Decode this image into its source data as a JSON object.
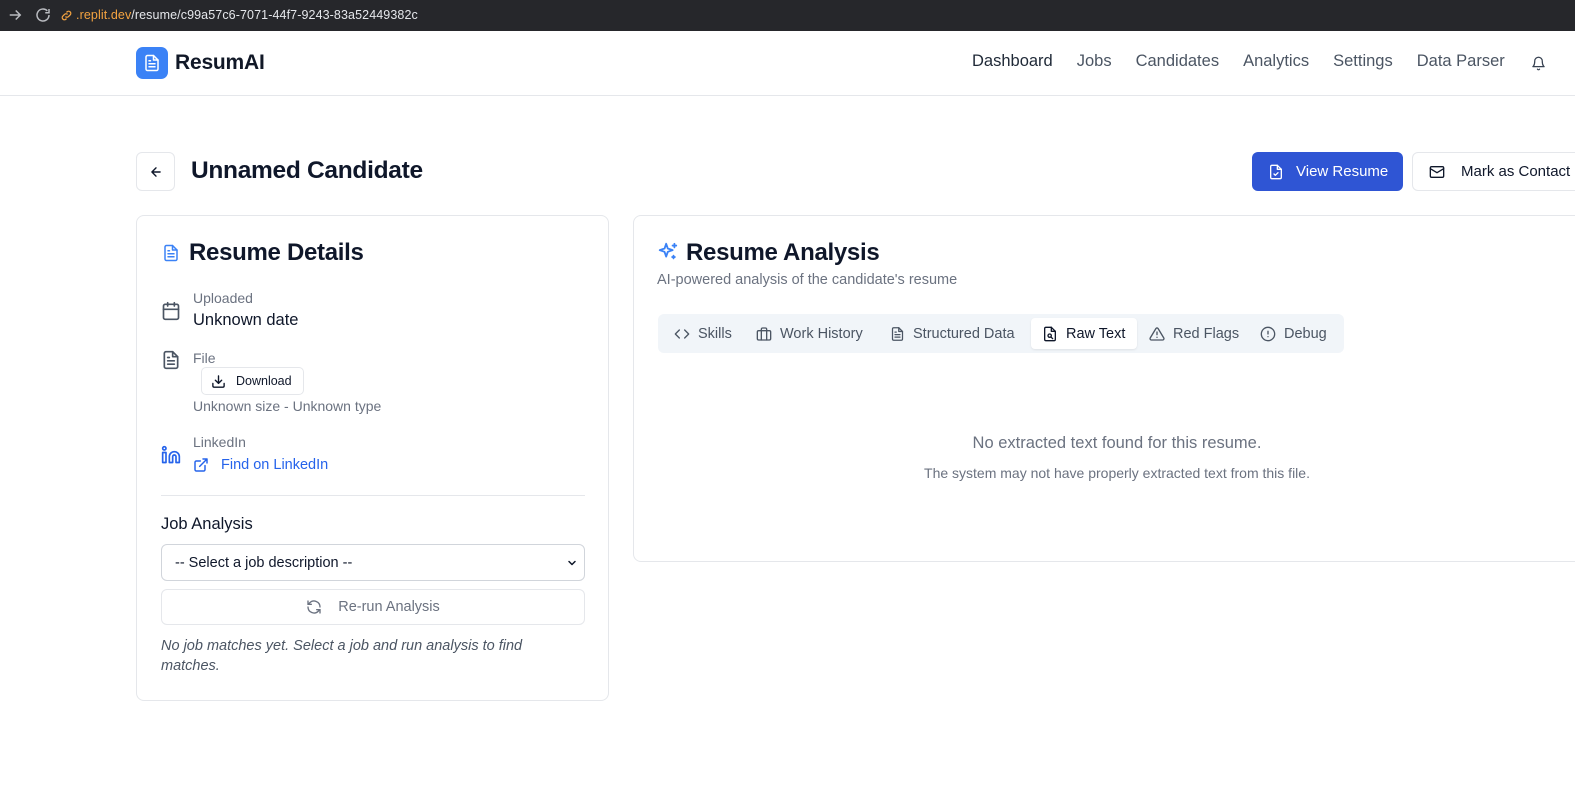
{
  "browser": {
    "url_host": ".replit.dev",
    "url_path": "/resume/c99a57c6-7071-44f7-9243-83a52449382c"
  },
  "header": {
    "brand": "ResumAI",
    "nav": [
      "Dashboard",
      "Jobs",
      "Candidates",
      "Analytics",
      "Settings",
      "Data Parser"
    ],
    "active_nav": "Dashboard"
  },
  "page": {
    "title": "Unnamed Candidate",
    "view_resume_label": "View Resume",
    "mark_contacted_label": "Mark as Contact"
  },
  "details": {
    "title": "Resume Details",
    "uploaded_label": "Uploaded",
    "uploaded_value": "Unknown date",
    "file_label": "File",
    "download_label": "Download",
    "file_meta": "Unknown size - Unknown type",
    "linkedin_label": "LinkedIn",
    "linkedin_link": "Find on LinkedIn",
    "job_analysis_title": "Job Analysis",
    "job_select_value": "-- Select a job description --",
    "rerun_label": "Re-run Analysis",
    "no_matches_note": "No job matches yet. Select a job and run analysis to find matches."
  },
  "analysis": {
    "title": "Resume Analysis",
    "subtitle": "AI-powered analysis of the candidate's resume",
    "tabs": [
      "Skills",
      "Work History",
      "Structured Data",
      "Raw Text",
      "Red Flags",
      "Debug"
    ],
    "active_tab": "Raw Text",
    "empty_title": "No extracted text found for this resume.",
    "empty_sub": "The system may not have properly extracted text from this file."
  },
  "colors": {
    "primary": "#2f55d4",
    "logo": "#3b82f6",
    "link": "#2563eb",
    "muted": "#6b7280"
  }
}
